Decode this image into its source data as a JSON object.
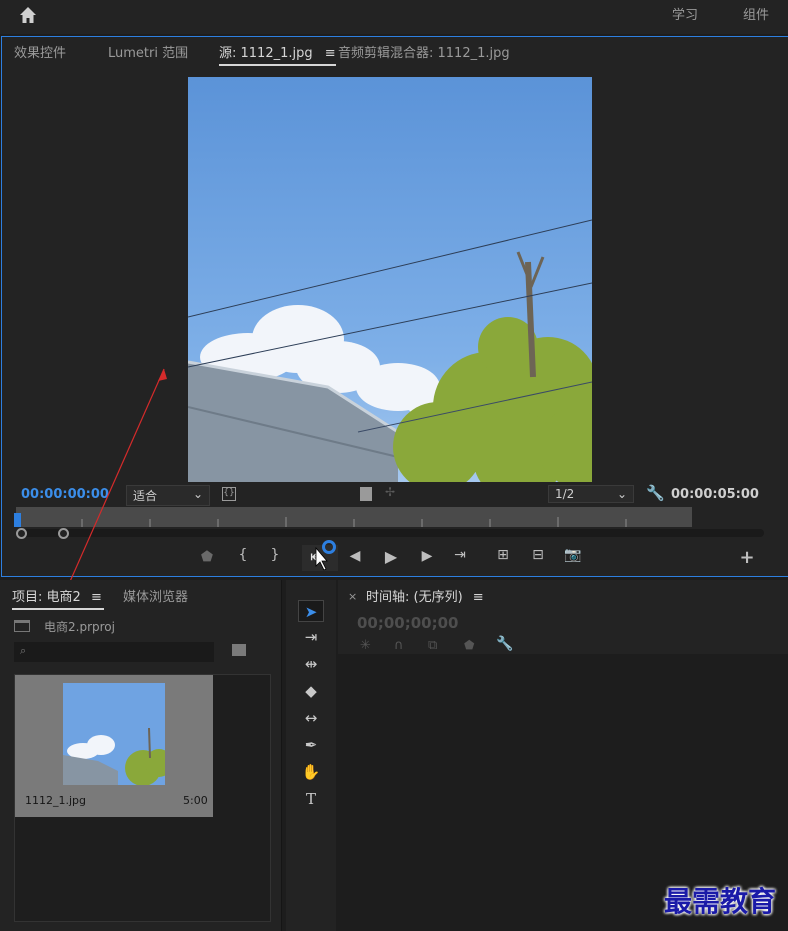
{
  "topbar": {
    "menu_learn": "学习",
    "menu_components": "组件"
  },
  "source": {
    "tabs": [
      {
        "label": "效果控件"
      },
      {
        "label": "Lumetri 范围"
      },
      {
        "label": "源: 1112_1.jpg"
      },
      {
        "label": "音频剪辑混合器: 1112_1.jpg"
      }
    ],
    "playhead_timecode": "00:00:00:00",
    "zoom_select": "适合",
    "resolution_select": "1/2",
    "duration_timecode": "00:00:05:00"
  },
  "project": {
    "tab_project": "项目: 电商2",
    "tab_media": "媒体浏览器",
    "project_file": "电商2.prproj",
    "item_name": "1112_1.jpg",
    "item_duration": "5:00"
  },
  "timeline": {
    "tab_label": "时间轴: (无序列)",
    "timecode": "00;00;00;00"
  },
  "watermark": "最需教育",
  "colors": {
    "accent": "#2d7fe0",
    "timecode_blue": "#3b8eea"
  }
}
